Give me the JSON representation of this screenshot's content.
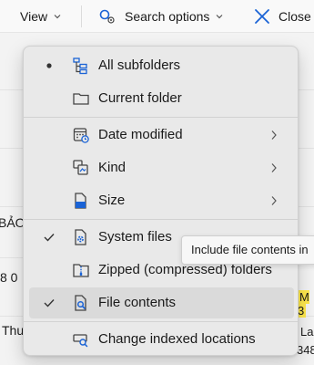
{
  "toolbar": {
    "view_label": "View",
    "search_options_label": "Search options",
    "close_label": "Close"
  },
  "background": {
    "fragment_1": "BẢO",
    "fragment_2": "8 0",
    "fragment_3": "Thu",
    "fragment_right_1": "M 3",
    "fragment_right_2": "Lai",
    "fragment_right_3": "348"
  },
  "tooltip": {
    "text": "Include file contents in"
  },
  "menu": {
    "items": [
      {
        "label": "All subfolders",
        "mark": "bullet",
        "icon": "subfolders-icon",
        "submenu": false
      },
      {
        "label": "Current folder",
        "mark": "",
        "icon": "folder-icon",
        "submenu": false
      },
      {
        "label": "Date modified",
        "mark": "",
        "icon": "calendar-icon",
        "submenu": true
      },
      {
        "label": "Kind",
        "mark": "",
        "icon": "kind-icon",
        "submenu": true
      },
      {
        "label": "Size",
        "mark": "",
        "icon": "size-icon",
        "submenu": true
      },
      {
        "label": "System files",
        "mark": "check",
        "icon": "system-file-icon",
        "submenu": false
      },
      {
        "label": "Zipped (compressed) folders",
        "mark": "",
        "icon": "zip-folder-icon",
        "submenu": false
      },
      {
        "label": "File contents",
        "mark": "check",
        "icon": "file-search-icon",
        "submenu": false,
        "highlighted": true
      },
      {
        "label": "Change indexed locations",
        "mark": "",
        "icon": "indexed-locations-icon",
        "submenu": false
      }
    ]
  },
  "colors": {
    "accent": "#1a63d6",
    "menu_bg": "#e9e9e9",
    "hover_bg": "#dadada",
    "highlight": "#ffe94d"
  }
}
